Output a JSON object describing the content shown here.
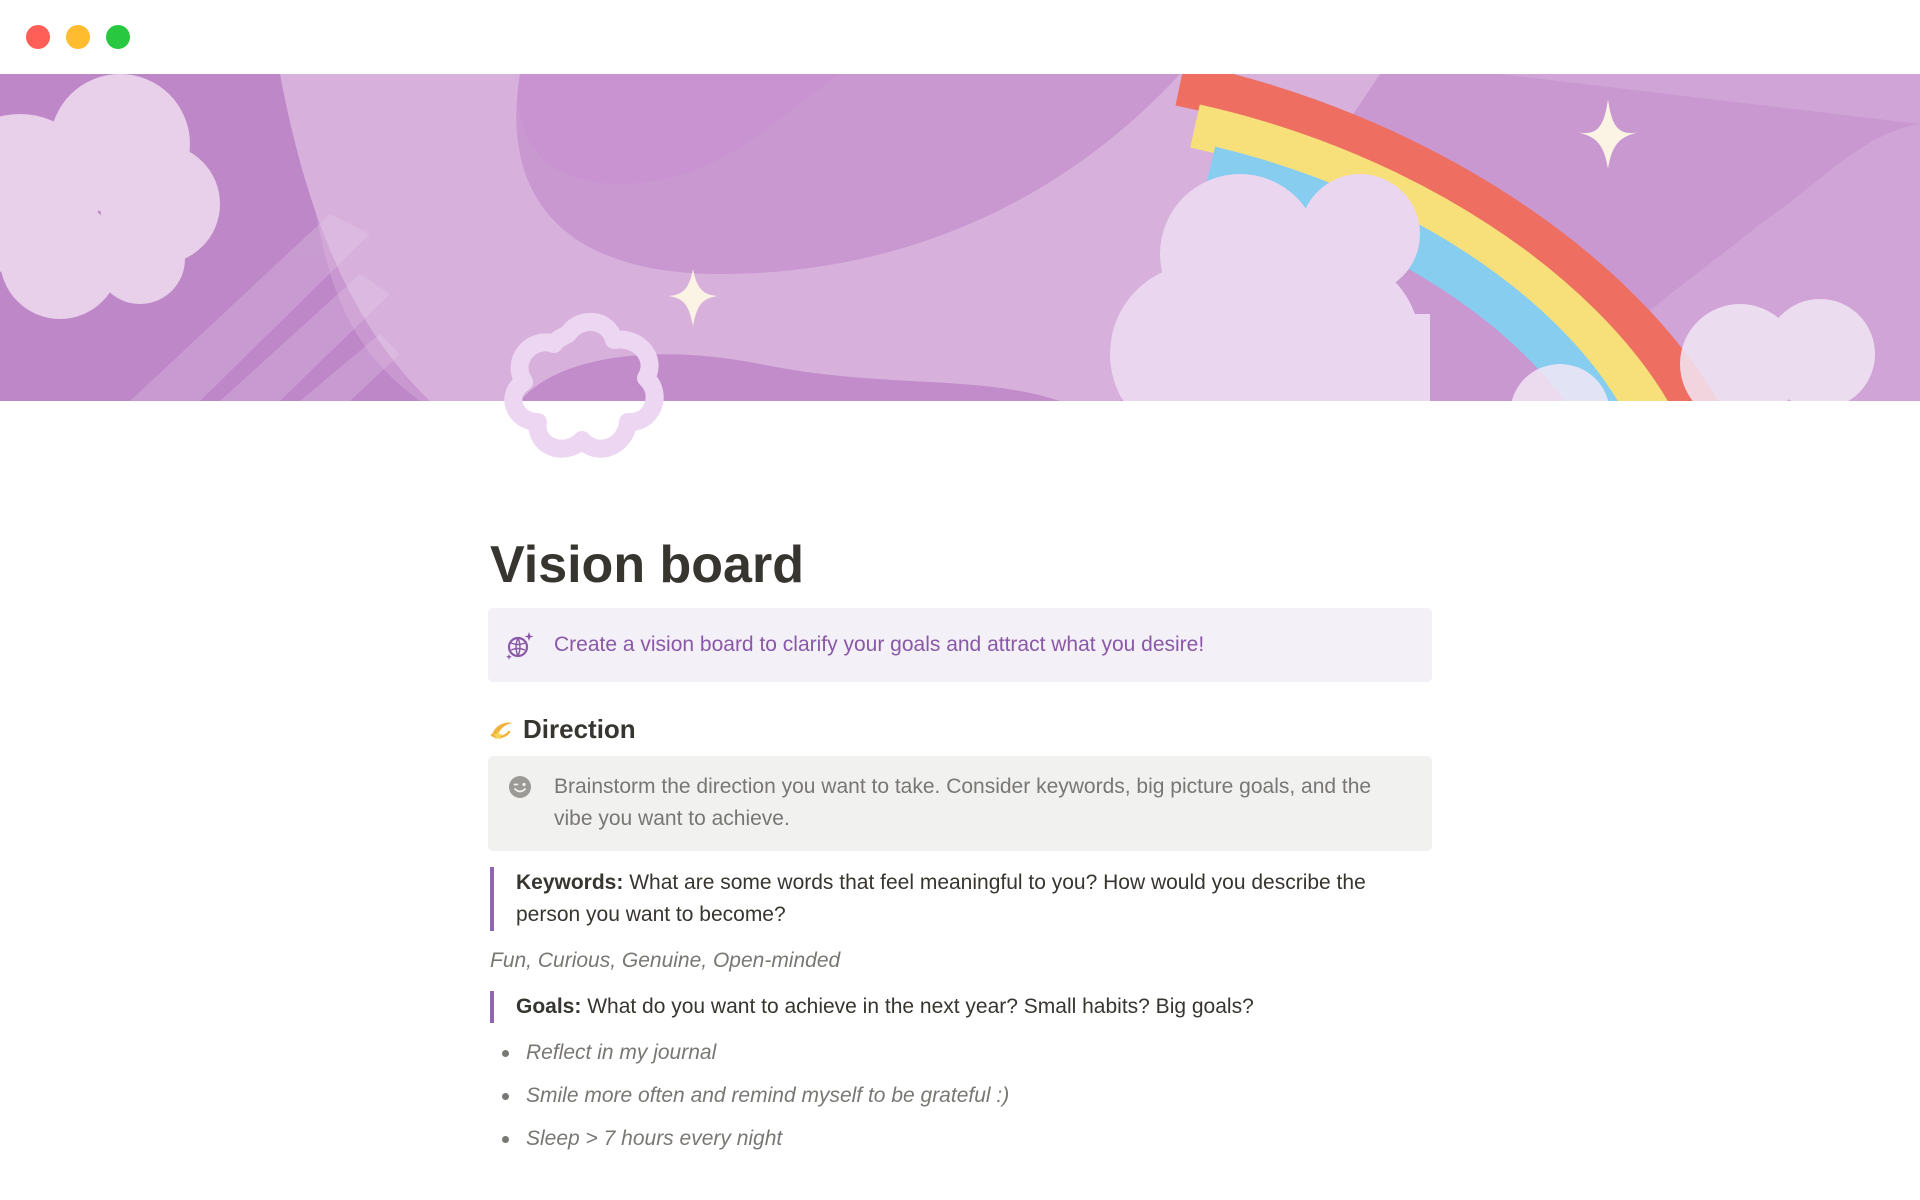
{
  "window": {
    "controls": [
      "close",
      "minimize",
      "zoom"
    ]
  },
  "cover": {
    "theme": "purple sky with rainbow, clouds and sparkles",
    "colors": {
      "sky": "#c998d1",
      "rainbow_red": "#ee6f61",
      "rainbow_yellow": "#f7e07a",
      "rainbow_blue": "#86cdf0"
    }
  },
  "page": {
    "icon": "flower-outline-icon",
    "title": "Vision board",
    "intro_callout": {
      "icon": "crystal-ball-sparkle-icon",
      "text": "Create a vision board to clarify your goals and attract what you desire!",
      "color": "#8a58a8",
      "background": "#f4f0f7"
    },
    "direction": {
      "emoji": "💫",
      "heading": "Direction",
      "callout": {
        "icon": "wink-face-icon",
        "text": "Brainstorm the direction you want to take. Consider keywords, big picture goals, and the vibe you want to achieve."
      },
      "keywords": {
        "label": "Keywords:",
        "prompt": " What are some words that feel meaningful to you? How would you describe the person you want to become?",
        "answer": "Fun, Curious, Genuine, Open-minded"
      },
      "goals": {
        "label": "Goals:",
        "prompt": " What do you want to achieve in the next year? Small habits? Big goals?",
        "items": [
          "Reflect in my journal",
          "Smile more often and remind myself to be grateful :)",
          "Sleep > 7 hours every night"
        ]
      }
    }
  },
  "colors": {
    "quote_bar": "#9065b0",
    "text": "#37352f",
    "muted": "#787774"
  }
}
